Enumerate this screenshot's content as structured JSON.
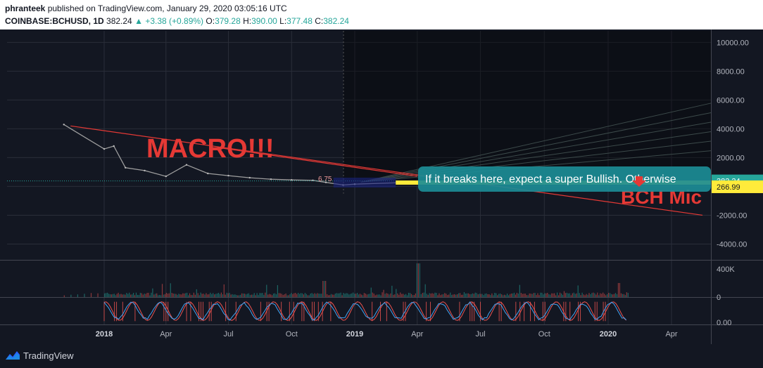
{
  "header": {
    "author": "phranteek",
    "published_text": "published on TradingView.com, January 29, 2020 03:05:16 UTC",
    "symbol": "COINBASE:BCHUSD, 1D",
    "last": "382.24",
    "change": "+3.38 (+0.89%)",
    "ohlc": {
      "o_label": "O:",
      "o": "379.28",
      "h_label": "H:",
      "h": "390.00",
      "l_label": "L:",
      "l": "377.48",
      "c_label": "C:",
      "c": "382.24"
    }
  },
  "annotations": {
    "macro": "MACRO!!!",
    "callout": "If it breaks here, expect a super Bullish. Otherwise",
    "bch_mic": "BCH Mic",
    "small_num": "6.75"
  },
  "price_tags": {
    "current": "382.24",
    "level": "266.99"
  },
  "colors": {
    "background": "#131722",
    "up": "#26a69a",
    "down": "#ef5350",
    "trendline": "#e53935",
    "callout": "#1c8c96",
    "level_tag": "#ffeb3b"
  },
  "footer": {
    "brand": "TradingView"
  },
  "chart_data": [
    {
      "type": "line",
      "title": "",
      "xlabel": "",
      "ylabel": "",
      "x_ticks": [
        "2018",
        "Apr",
        "Jul",
        "Oct",
        "2019",
        "Apr",
        "Jul",
        "Oct",
        "2020",
        "Apr"
      ],
      "y_ticks": [
        "10000.00",
        "8000.00",
        "6000.00",
        "4000.00",
        "2000.00",
        "-2000.00",
        "-4000.00"
      ],
      "ylim": [
        -5100,
        10800
      ],
      "series": [
        {
          "x": [
            "2017-12-20",
            "2018-01-01",
            "2018-01-15",
            "2018-02-01",
            "2018-03-01",
            "2018-04-01",
            "2018-05-01",
            "2018-06-01",
            "2018-07-01",
            "2018-08-01",
            "2018-09-01",
            "2018-10-01",
            "2018-11-01",
            "2018-11-20",
            "2018-12-15",
            "2019-01-01",
            "2019-04-01",
            "2019-06-15",
            "2019-07-01",
            "2019-10-01",
            "2020-01-01",
            "2020-01-29"
          ],
          "values": [
            4300,
            2600,
            2800,
            1300,
            1100,
            700,
            1500,
            900,
            750,
            600,
            500,
            450,
            420,
            280,
            100,
            160,
            300,
            450,
            360,
            230,
            250,
            382
          ]
        }
      ],
      "trendline": {
        "from": [
          "2017-12-22",
          4200
        ],
        "to": [
          "2020-05-15",
          -2000
        ]
      }
    },
    {
      "type": "bar",
      "title": "",
      "y_ticks": [
        "400K",
        "0"
      ],
      "ylim": [
        0,
        520000
      ]
    },
    {
      "type": "line",
      "title": "",
      "y_ticks": [
        "0.00"
      ],
      "ylim": [
        -0.1,
        1.1
      ]
    }
  ]
}
